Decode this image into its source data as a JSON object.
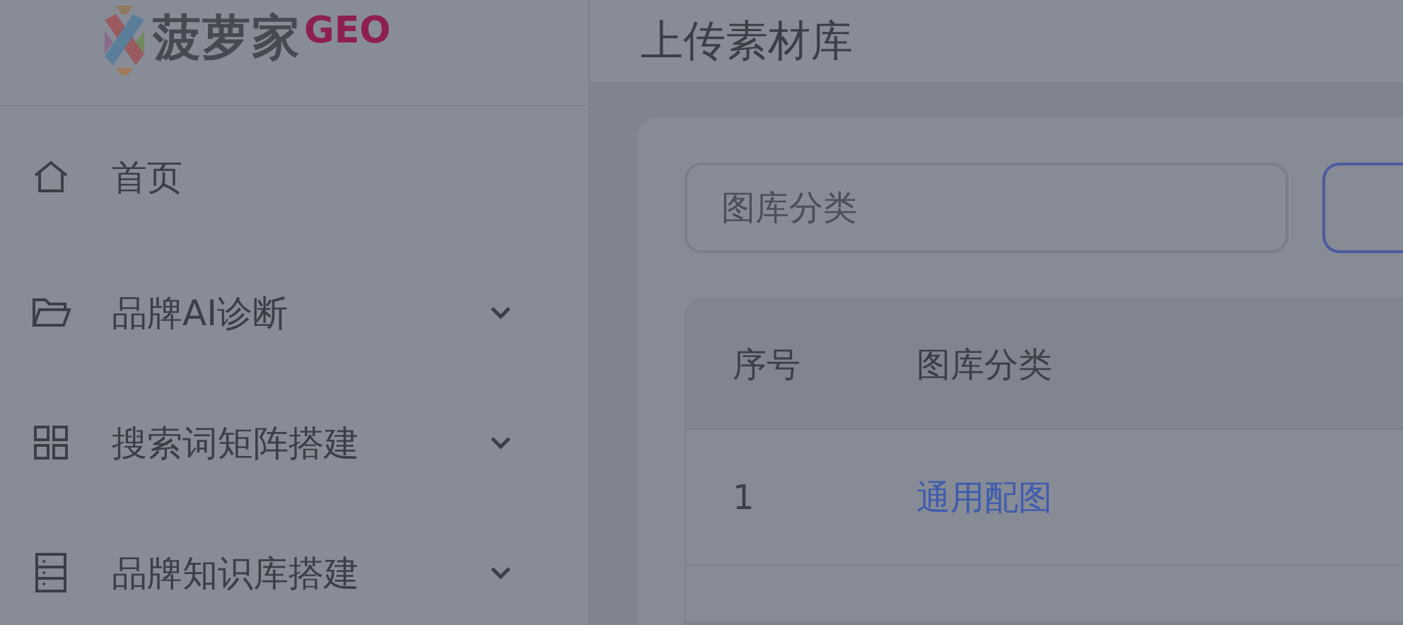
{
  "logo": {
    "name": "菠萝家",
    "badge": "GEO"
  },
  "sidebar": {
    "items": [
      {
        "label": "首页",
        "kind": "home",
        "expandable": false
      },
      {
        "label": "品牌AI诊断",
        "kind": "folder",
        "expandable": true
      },
      {
        "label": "搜索词矩阵搭建",
        "kind": "grid",
        "expandable": true
      },
      {
        "label": "品牌知识库搭建",
        "kind": "server",
        "expandable": true
      }
    ]
  },
  "header": {
    "title": "上传素材库"
  },
  "search": {
    "placeholder": "图库分类"
  },
  "table": {
    "columns": [
      "序号",
      "图库分类"
    ],
    "rows": [
      {
        "index": "1",
        "category": "通用配图"
      }
    ]
  }
}
